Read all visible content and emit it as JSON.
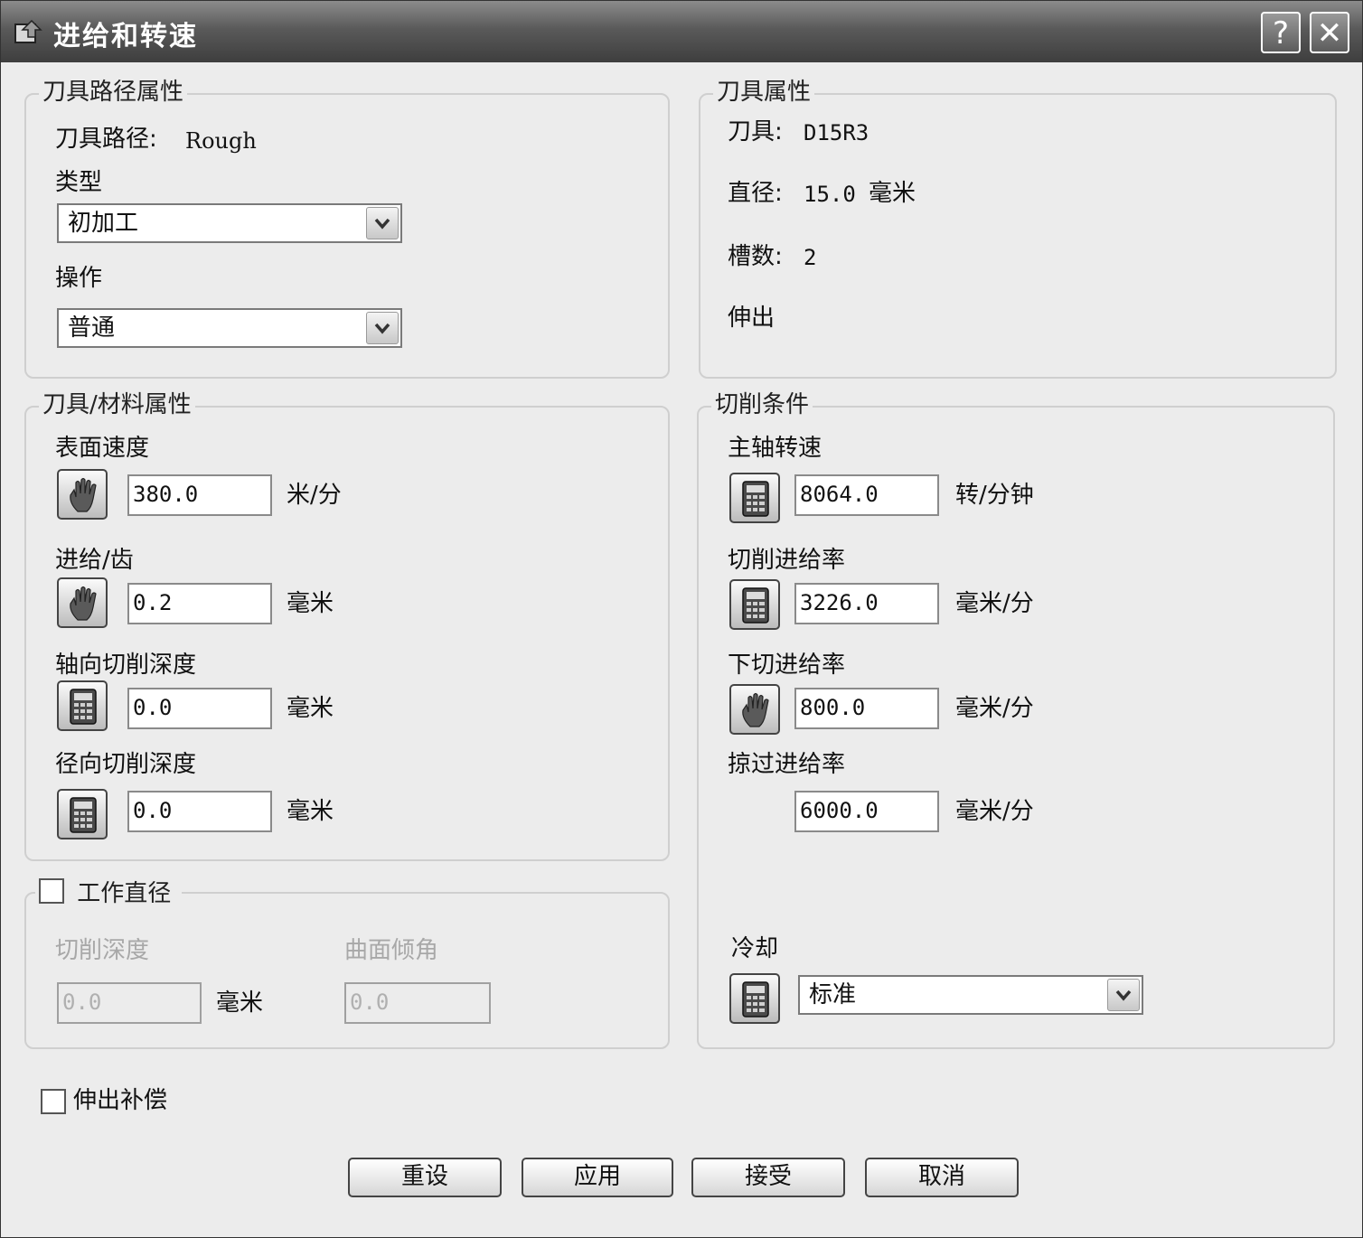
{
  "window": {
    "title": "进给和转速"
  },
  "titlebar": {
    "help_label": "?",
    "close_label": "✕"
  },
  "toolpath_group": {
    "legend": "刀具路径属性",
    "toolpath_label": "刀具路径:",
    "toolpath_value": "Rough",
    "type_label": "类型",
    "type_value": "初加工",
    "operation_label": "操作",
    "operation_value": "普通"
  },
  "tool_group": {
    "legend": "刀具属性",
    "tool_label": "刀具:",
    "tool_value": "D15R3",
    "diameter_label": "直径:",
    "diameter_value": "15.0",
    "diameter_unit": "毫米",
    "flutes_label": "槽数:",
    "flutes_value": "2",
    "overhang_label": "伸出"
  },
  "material_group": {
    "legend": "刀具/材料属性",
    "surface_speed": {
      "label": "表面速度",
      "value": "380.0",
      "unit": "米/分",
      "icon": "hand-icon"
    },
    "feed_per_tooth": {
      "label": "进给/齿",
      "value": "0.2",
      "unit": "毫米",
      "icon": "hand-icon"
    },
    "axial_depth": {
      "label": "轴向切削深度",
      "value": "0.0",
      "unit": "毫米",
      "icon": "calculator-icon"
    },
    "radial_depth": {
      "label": "径向切削深度",
      "value": "0.0",
      "unit": "毫米",
      "icon": "calculator-icon"
    }
  },
  "cutting_group": {
    "legend": "切削条件",
    "spindle_speed": {
      "label": "主轴转速",
      "value": "8064.0",
      "unit": "转/分钟",
      "icon": "calculator-icon"
    },
    "cutting_feed": {
      "label": "切削进给率",
      "value": "3226.0",
      "unit": "毫米/分",
      "icon": "calculator-icon"
    },
    "plunge_feed": {
      "label": "下切进给率",
      "value": "800.0",
      "unit": "毫米/分",
      "icon": "hand-icon"
    },
    "skim_feed": {
      "label": "掠过进给率",
      "value": "6000.0",
      "unit": "毫米/分"
    },
    "coolant_label": "冷却",
    "coolant_value": "标准"
  },
  "working_diameter": {
    "legend": "工作直径",
    "checked": false,
    "cut_depth_label": "切削深度",
    "cut_depth_value": "0.0",
    "cut_depth_unit": "毫米",
    "surface_angle_label": "曲面倾角",
    "surface_angle_value": "0.0"
  },
  "overhang_comp": {
    "label": "伸出补偿",
    "checked": false
  },
  "buttons": {
    "reset": "重设",
    "apply": "应用",
    "accept": "接受",
    "cancel": "取消"
  }
}
